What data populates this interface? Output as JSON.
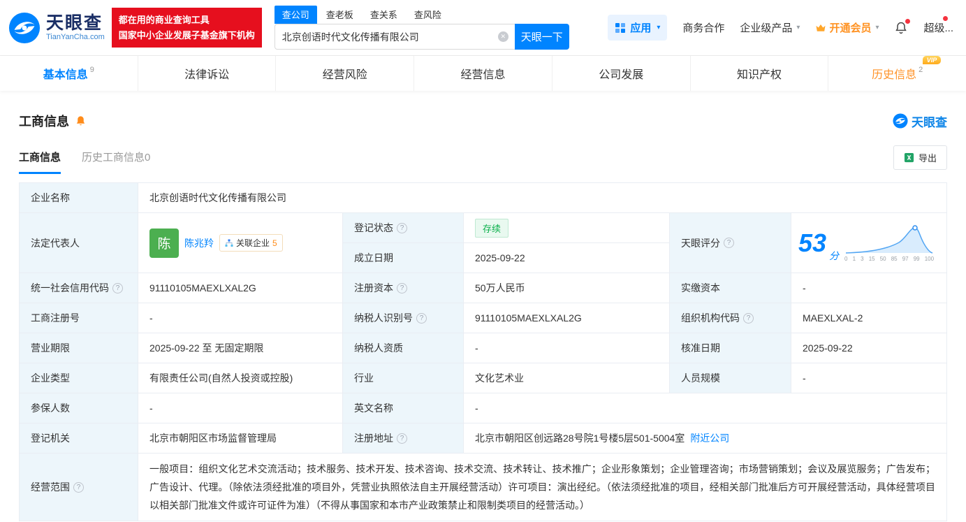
{
  "colors": {
    "accent": "#0084ff",
    "banner_red": "#e60f1e",
    "vip_orange": "#ff9329",
    "status_green": "#0bb04b"
  },
  "icons": {
    "clear": "✕",
    "caret": "▾",
    "help": "?"
  },
  "header": {
    "logo": {
      "title": "天眼查",
      "subtitle": "TianYanCha.com"
    },
    "slogan": {
      "line1": "都在用的商业查询工具",
      "line2": "国家中小企业发展子基金旗下机构"
    },
    "search_tabs": [
      {
        "label": "查公司"
      },
      {
        "label": "查老板"
      },
      {
        "label": "查关系"
      },
      {
        "label": "查风险"
      }
    ],
    "search": {
      "value": "北京创语时代文化传播有限公司",
      "button": "天眼一下"
    },
    "nav": {
      "apps": "应用",
      "coop": "商务合作",
      "enterprise": "企业级产品",
      "membership": "开通会员",
      "super": "超级..."
    }
  },
  "tabs": [
    {
      "label": "基本信息",
      "badge": "9"
    },
    {
      "label": "法律诉讼"
    },
    {
      "label": "经营风险"
    },
    {
      "label": "经营信息"
    },
    {
      "label": "公司发展"
    },
    {
      "label": "知识产权"
    },
    {
      "label": "历史信息",
      "badge": "2",
      "vip": "VIP"
    }
  ],
  "section": {
    "title": "工商信息",
    "watermark": "天眼查",
    "subtabs": [
      {
        "label": "工商信息"
      },
      {
        "label": "历史工商信息0"
      }
    ],
    "export_label": "导出"
  },
  "fields": {
    "company_name": {
      "label": "企业名称",
      "value": "北京创语时代文化传播有限公司"
    },
    "legal_rep": {
      "label": "法定代表人",
      "avatar": "陈",
      "name": "陈兆羚",
      "related_label": "关联企业",
      "related_count": "5"
    },
    "reg_status": {
      "label": "登记状态",
      "value": "存续"
    },
    "establish_date": {
      "label": "成立日期",
      "value": "2025-09-22"
    },
    "score": {
      "label": "天眼评分",
      "value": "53",
      "unit": "分",
      "axis": [
        "0",
        "1",
        "3",
        "15",
        "50",
        "85",
        "97",
        "99",
        "100"
      ]
    },
    "credit_code": {
      "label": "统一社会信用代码",
      "value": "91110105MAEXLXAL2G"
    },
    "reg_capital": {
      "label": "注册资本",
      "value": "50万人民币"
    },
    "paid_capital": {
      "label": "实缴资本",
      "value": "-"
    },
    "reg_number": {
      "label": "工商注册号",
      "value": "-"
    },
    "taxpayer_id": {
      "label": "纳税人识别号",
      "value": "91110105MAEXLXAL2G"
    },
    "org_code": {
      "label": "组织机构代码",
      "value": "MAEXLXAL-2"
    },
    "business_term": {
      "label": "营业期限",
      "value": "2025-09-22 至 无固定期限"
    },
    "taxpayer_quality": {
      "label": "纳税人资质",
      "value": "-"
    },
    "approval_date": {
      "label": "核准日期",
      "value": "2025-09-22"
    },
    "company_type": {
      "label": "企业类型",
      "value": "有限责任公司(自然人投资或控股)"
    },
    "industry": {
      "label": "行业",
      "value": "文化艺术业"
    },
    "staff_size": {
      "label": "人员规模",
      "value": "-"
    },
    "insured_count": {
      "label": "参保人数",
      "value": "-"
    },
    "english_name": {
      "label": "英文名称",
      "value": "-"
    },
    "reg_authority": {
      "label": "登记机关",
      "value": "北京市朝阳区市场监督管理局"
    },
    "reg_address": {
      "label": "注册地址",
      "value": "北京市朝阳区创远路28号院1号楼5层501-5004室",
      "link": "附近公司"
    },
    "business_scope": {
      "label": "经营范围",
      "value": "一般项目：组织文化艺术交流活动；技术服务、技术开发、技术咨询、技术交流、技术转让、技术推广；企业形象策划；企业管理咨询；市场营销策划；会议及展览服务；广告发布；广告设计、代理。（除依法须经批准的项目外，凭营业执照依法自主开展经营活动）许可项目：演出经纪。（依法须经批准的项目，经相关部门批准后方可开展经营活动，具体经营项目以相关部门批准文件或许可证件为准）（不得从事国家和本市产业政策禁止和限制类项目的经营活动。）"
    }
  }
}
